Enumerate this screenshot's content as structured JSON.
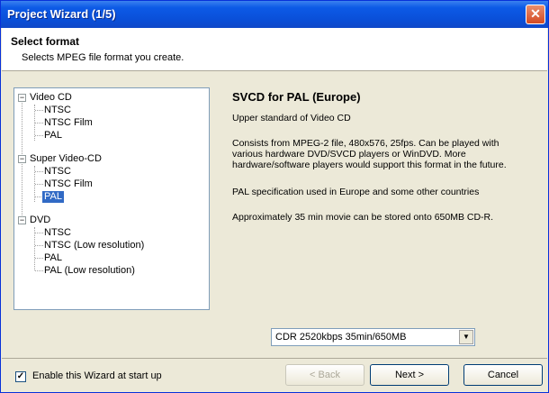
{
  "window": {
    "title": "Project Wizard (1/5)"
  },
  "header": {
    "title": "Select format",
    "subtitle": "Selects MPEG file format you create."
  },
  "tree": {
    "groups": [
      {
        "label": "Video CD",
        "items": [
          "NTSC",
          "NTSC Film",
          "PAL"
        ]
      },
      {
        "label": "Super Video-CD",
        "items": [
          "NTSC",
          "NTSC Film",
          "PAL"
        ]
      },
      {
        "label": "DVD",
        "items": [
          "NTSC",
          "NTSC (Low resolution)",
          "PAL",
          "PAL (Low resolution)"
        ]
      }
    ],
    "selected": "Super Video-CD / PAL"
  },
  "description": {
    "title": "SVCD for PAL (Europe)",
    "p1": "Upper standard of Video CD",
    "p2_l1": "Consists from MPEG-2 file, 480x576, 25fps. Can be played with",
    "p2_l2": "various hardware DVD/SVCD players or WinDVD. More",
    "p2_l3": "hardware/software players would support this format in the future.",
    "p3": "PAL specification used in Europe and some other countries",
    "p4": "Approximately 35 min movie can be stored onto 650MB CD-R."
  },
  "bitrate_select": {
    "value": "CDR 2520kbps  35min/650MB"
  },
  "footer": {
    "enable_wizard_label": "Enable this Wizard at start up",
    "enable_wizard_checked": true,
    "back_label": "< Back",
    "next_label": "Next >",
    "cancel_label": "Cancel"
  },
  "colors": {
    "titlebar": "#0a4fd8",
    "selection": "#316ac5",
    "dialog_bg": "#ece9d8"
  }
}
